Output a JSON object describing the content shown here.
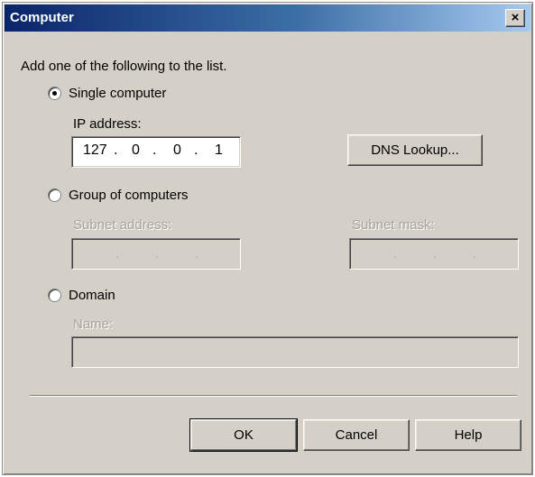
{
  "window": {
    "title": "Computer",
    "close_label": "×"
  },
  "instructions": "Add one of the following to the list.",
  "single": {
    "label": "Single computer",
    "selected": true,
    "ip_label": "IP address:",
    "ip": [
      "127",
      "0",
      "0",
      "1"
    ],
    "dns_button": "DNS Lookup..."
  },
  "group": {
    "label": "Group of computers",
    "selected": false,
    "subnet_address_label": "Subnet address:",
    "subnet_mask_label": "Subnet mask:"
  },
  "domain": {
    "label": "Domain",
    "selected": false,
    "name_label": "Name:"
  },
  "buttons": {
    "ok": "OK",
    "cancel": "Cancel",
    "help": "Help"
  }
}
